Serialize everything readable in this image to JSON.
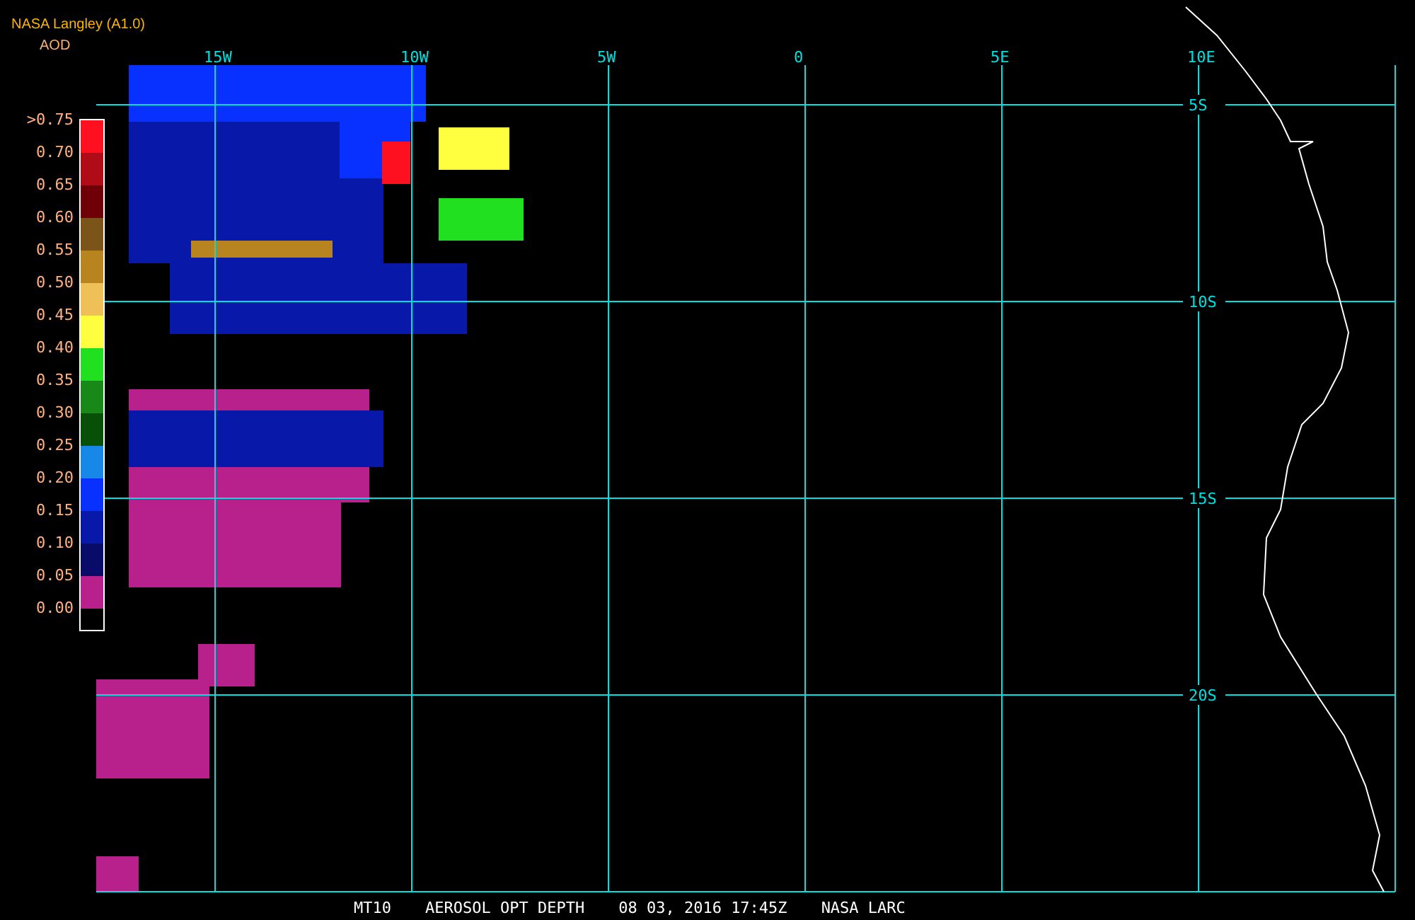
{
  "header": {
    "title": "NASA Langley (A1.0)",
    "subtitle": "AOD"
  },
  "legend": {
    "labels": [
      ">0.75",
      "0.70",
      "0.65",
      "0.60",
      "0.55",
      "0.50",
      "0.45",
      "0.40",
      "0.35",
      "0.30",
      "0.25",
      "0.20",
      "0.15",
      "0.10",
      "0.05",
      "0.00"
    ],
    "swatches": [
      {
        "color": "#ff1020"
      },
      {
        "color": "#b00c18"
      },
      {
        "color": "#700008"
      },
      {
        "color": "#7a5418"
      },
      {
        "color": "#b88420"
      },
      {
        "color": "#f0c058"
      },
      {
        "color": "#ffff40"
      },
      {
        "color": "#20e020"
      },
      {
        "color": "#188818"
      },
      {
        "color": "#085008"
      },
      {
        "color": "#1888e8"
      },
      {
        "color": "#0830ff"
      },
      {
        "color": "#0818a8"
      },
      {
        "color": "#080c68"
      },
      {
        "color": "#b8208c"
      }
    ]
  },
  "map": {
    "longitudes": [
      "15W",
      "10W",
      "5W",
      "0",
      "5E",
      "10E"
    ],
    "latitudes": [
      "5S",
      "10S",
      "15S",
      "20S"
    ]
  },
  "footer": [
    "MT10",
    "AEROSOL OPT DEPTH",
    "08 03, 2016 17:45Z",
    "NASA LARC"
  ]
}
